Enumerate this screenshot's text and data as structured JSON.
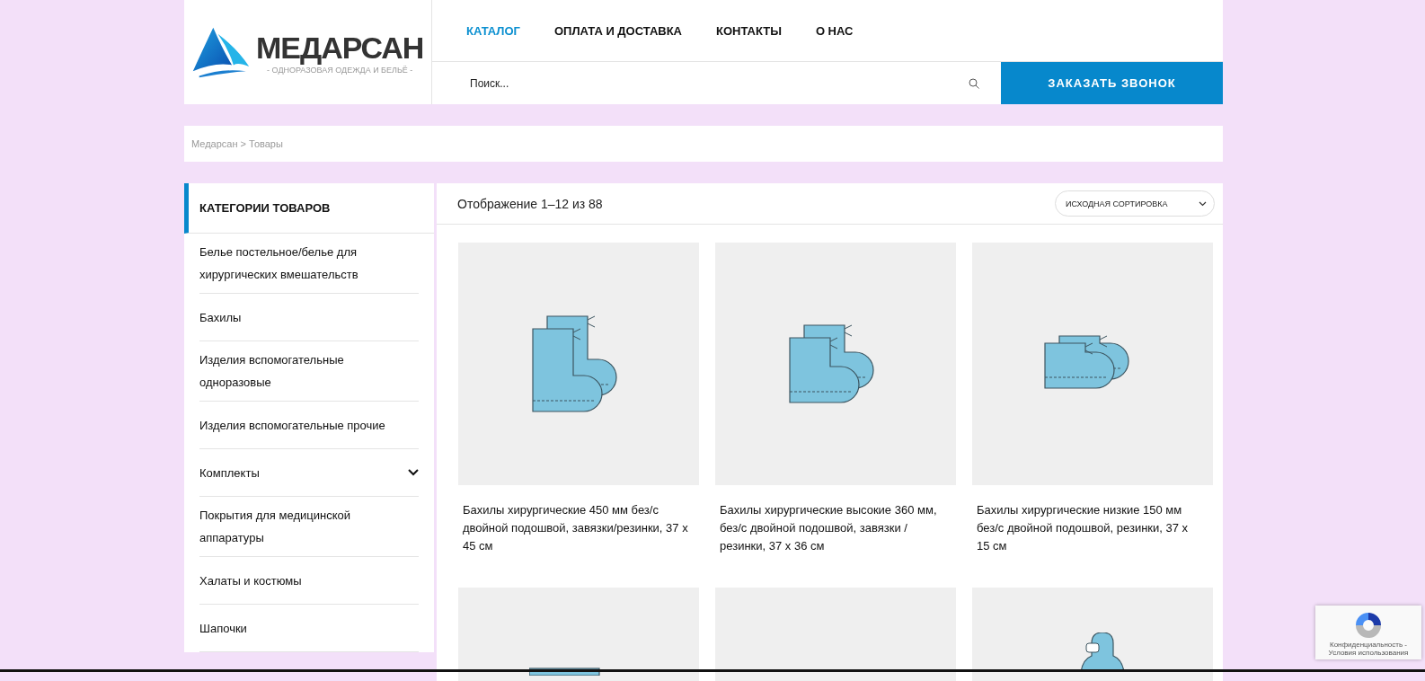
{
  "logo": {
    "name": "МЕДАРСАН",
    "tagline": "- ОДНОРАЗОВАЯ ОДЕЖДА И БЕЛЬЁ -"
  },
  "nav": [
    {
      "label": "КАТАЛОГ",
      "selected": true
    },
    {
      "label": "ОПЛАТА И ДОСТАВКА",
      "selected": false
    },
    {
      "label": "КОНТАКТЫ",
      "selected": false
    },
    {
      "label": "О НАС",
      "selected": false
    }
  ],
  "search": {
    "placeholder": "Поиск..."
  },
  "call_button": "ЗАКАЗАТЬ ЗВОНОК",
  "breadcrumb": "Медарсан > Товары",
  "sidebar": {
    "title": "КАТЕГОРИИ ТОВАРОВ",
    "items": [
      {
        "label": "Белье постельное/белье для хирургических вмешательств",
        "has_children": false
      },
      {
        "label": "Бахилы",
        "has_children": false
      },
      {
        "label": "Изделия вспомогательные одноразовые",
        "has_children": false
      },
      {
        "label": "Изделия вспомогательные прочие",
        "has_children": false
      },
      {
        "label": "Комплекты",
        "has_children": true
      },
      {
        "label": "Покрытия для медицинской аппаратуры",
        "has_children": false
      },
      {
        "label": "Халаты и костюмы",
        "has_children": false
      },
      {
        "label": "Шапочки",
        "has_children": false
      }
    ]
  },
  "result_count": "Отображение 1–12 из 88",
  "sort": {
    "value": "ИСХОДНАЯ СОРТИРОВКА"
  },
  "products": [
    {
      "kind": "boots-high",
      "title": "Бахилы хирургические 450 мм без/с двойной подошвой, завязки/резинки, 37 x 45 см"
    },
    {
      "kind": "boots-mid",
      "title": "Бахилы хирургические высокие 360 мм, без/с двойной подошвой, завязки / резинки, 37 x 36 см"
    },
    {
      "kind": "boots-low",
      "title": "Бахилы хирургические низкие 150 мм без/с двойной подошвой, резинки, 37 x 15 см"
    },
    {
      "kind": "cover"
    },
    {
      "kind": "blank"
    },
    {
      "kind": "suit"
    }
  ],
  "recaptcha": "Конфиденциальность - Условия использования"
}
